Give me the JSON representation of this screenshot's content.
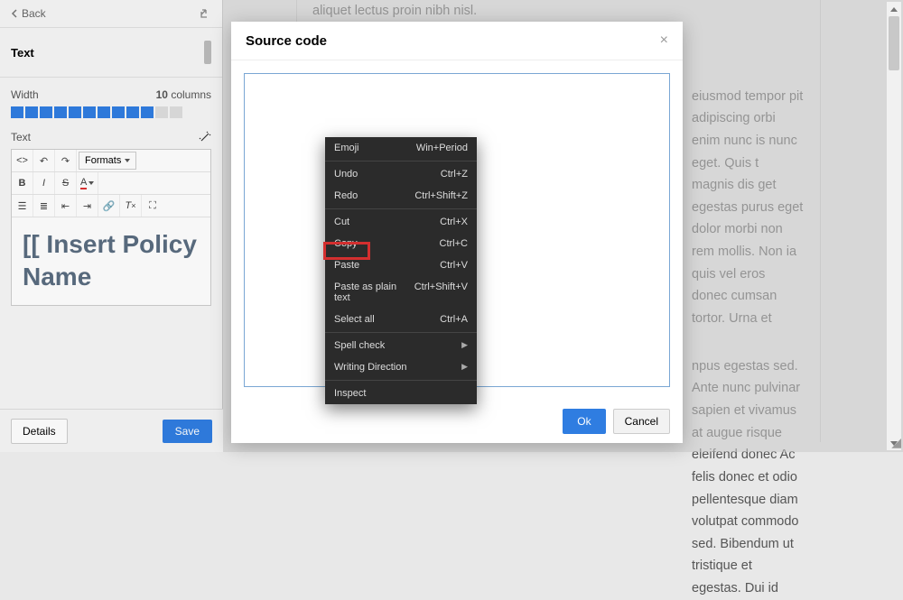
{
  "left": {
    "back": "Back",
    "section": "Text",
    "width_label": "Width",
    "columns_value": "10",
    "columns_suffix": "columns",
    "text_label": "Text",
    "formats": "Formats",
    "content": "[[ Insert Policy Name",
    "details": "Details",
    "save": "Save"
  },
  "modal": {
    "title": "Source code",
    "ok": "Ok",
    "cancel": "Cancel"
  },
  "ctx": {
    "emoji": "Emoji",
    "emoji_k": "Win+Period",
    "undo": "Undo",
    "undo_k": "Ctrl+Z",
    "redo": "Redo",
    "redo_k": "Ctrl+Shift+Z",
    "cut": "Cut",
    "cut_k": "Ctrl+X",
    "copy": "Copy",
    "copy_k": "Ctrl+C",
    "paste": "Paste",
    "paste_k": "Ctrl+V",
    "paste_plain": "Paste as plain text",
    "paste_plain_k": "Ctrl+Shift+V",
    "select_all": "Select all",
    "select_all_k": "Ctrl+A",
    "spell": "Spell check",
    "writing": "Writing Direction",
    "inspect": "Inspect"
  },
  "bg": {
    "line0": "aliquet lectus proin nibh nisl.",
    "p1": "eiusmod tempor pit adipiscing orbi enim nunc is nunc eget. Quis t magnis dis get egestas purus eget dolor morbi non rem mollis. Non ia quis vel eros donec cumsan tortor. Urna et",
    "p2": "npus egestas sed. Ante nunc pulvinar sapien et vivamus at augue risque eleifend donec Ac felis donec et odio pellentesque diam volutpat commodo sed. Bibendum ut tristique et egestas. Dui id"
  }
}
